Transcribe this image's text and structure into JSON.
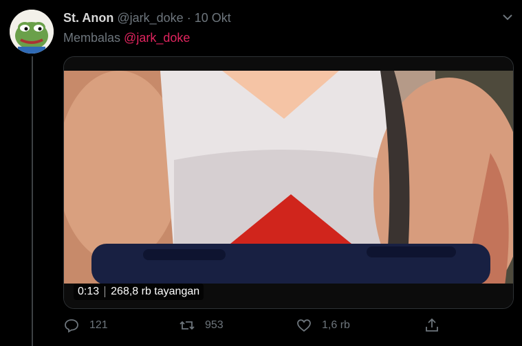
{
  "tweet": {
    "display_name": "St. Anon",
    "handle": "@jark_doke",
    "separator": "·",
    "date": "10 Okt",
    "reply_prefix": "Membalas",
    "reply_mention": "@jark_doke",
    "media": {
      "duration": "0:13",
      "views": "268,8 rb tayangan"
    },
    "actions": {
      "replies": "121",
      "retweets": "953",
      "likes": "1,6 rb"
    }
  },
  "colors": {
    "background": "#000000",
    "mention": "#e0245e",
    "muted": "#6e767d"
  }
}
